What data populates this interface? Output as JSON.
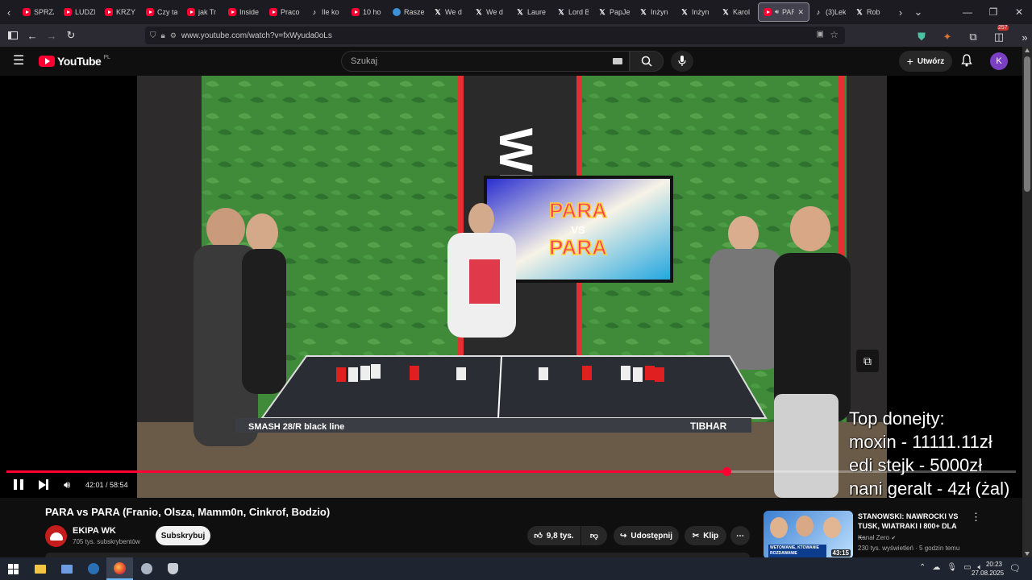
{
  "browser": {
    "tabs": [
      {
        "label": "SPRZA",
        "icon": "youtube-icon"
      },
      {
        "label": "LUDZI",
        "icon": "youtube-icon"
      },
      {
        "label": "KRZY",
        "icon": "youtube-icon"
      },
      {
        "label": "Czy ta",
        "icon": "youtube-icon"
      },
      {
        "label": "jak Tr",
        "icon": "youtube-icon"
      },
      {
        "label": "Inside",
        "icon": "youtube-icon"
      },
      {
        "label": "Praco",
        "icon": "youtube-icon"
      },
      {
        "label": "Ile ko",
        "icon": "tiktok-icon"
      },
      {
        "label": "10 ho",
        "icon": "youtube-icon"
      },
      {
        "label": "Rasze",
        "icon": "messenger-icon"
      },
      {
        "label": "We d",
        "icon": "x-icon"
      },
      {
        "label": "We d",
        "icon": "x-icon"
      },
      {
        "label": "Laure",
        "icon": "x-icon"
      },
      {
        "label": "Lord B",
        "icon": "x-icon"
      },
      {
        "label": "PapJe",
        "icon": "x-icon"
      },
      {
        "label": "Inżyn",
        "icon": "x-icon"
      },
      {
        "label": "Inżyn",
        "icon": "x-icon"
      },
      {
        "label": "Karol",
        "icon": "x-icon"
      },
      {
        "label": "PAR",
        "icon": "youtube-icon",
        "active": true
      },
      {
        "label": "(3)Lek",
        "icon": "tiktok-icon"
      },
      {
        "label": "Rob",
        "icon": "x-icon"
      }
    ],
    "url": "www.youtube.com/watch?v=fxWyuda0oLs",
    "extension_badge": "257"
  },
  "youtube": {
    "logo_text": "YouTube",
    "logo_region": "PL",
    "search_placeholder": "Szukaj",
    "create_label": "Utwórz",
    "avatar_letter": "K"
  },
  "player": {
    "time_current": "42:01",
    "time_total": "58:54",
    "progress_fraction": 0.713,
    "scene": {
      "brand_sign": "WK",
      "screen_title_top": "PARA",
      "screen_title_vs": "VS",
      "screen_title_bottom": "PARA",
      "table_brand_left": "SMASH 28/R black line",
      "table_brand_right": "TIBHAR"
    },
    "overlay": {
      "heading": "Top donejty:",
      "lines": [
        "moxin - 11111.11zł",
        "edi stejk - 5000zł",
        "nani geralt - 4zł (żal)"
      ]
    }
  },
  "video_meta": {
    "title": "PARA vs PARA (Franio, Olsza, Mamm0n, Cinkrof, Bodzio)",
    "channel_name": "EKIPA WK",
    "subscribers": "705 tys. subskrybentów",
    "subscribe_label": "Subskrybuj",
    "likes": "9,8 tys.",
    "share_label": "Udostępnij",
    "clip_label": "Klip"
  },
  "recommended": {
    "title": "STANOWSKI: NAWROCKI VS TUSK, WIATRAKI I 800+ DLA ...",
    "channel": "Kanał Zero",
    "stats": "230 tys. wyświetleń · 5 godzin temu",
    "duration": "43:15",
    "thumb_caption": "WETOWANIE, KTOWANIE ROZDAWANIE"
  },
  "taskbar": {
    "time": "20:23",
    "date": "27.08.2025"
  },
  "colors": {
    "yt_red": "#ff0033",
    "background": "#0f0f0f",
    "wall_green": "#3d8a39"
  }
}
